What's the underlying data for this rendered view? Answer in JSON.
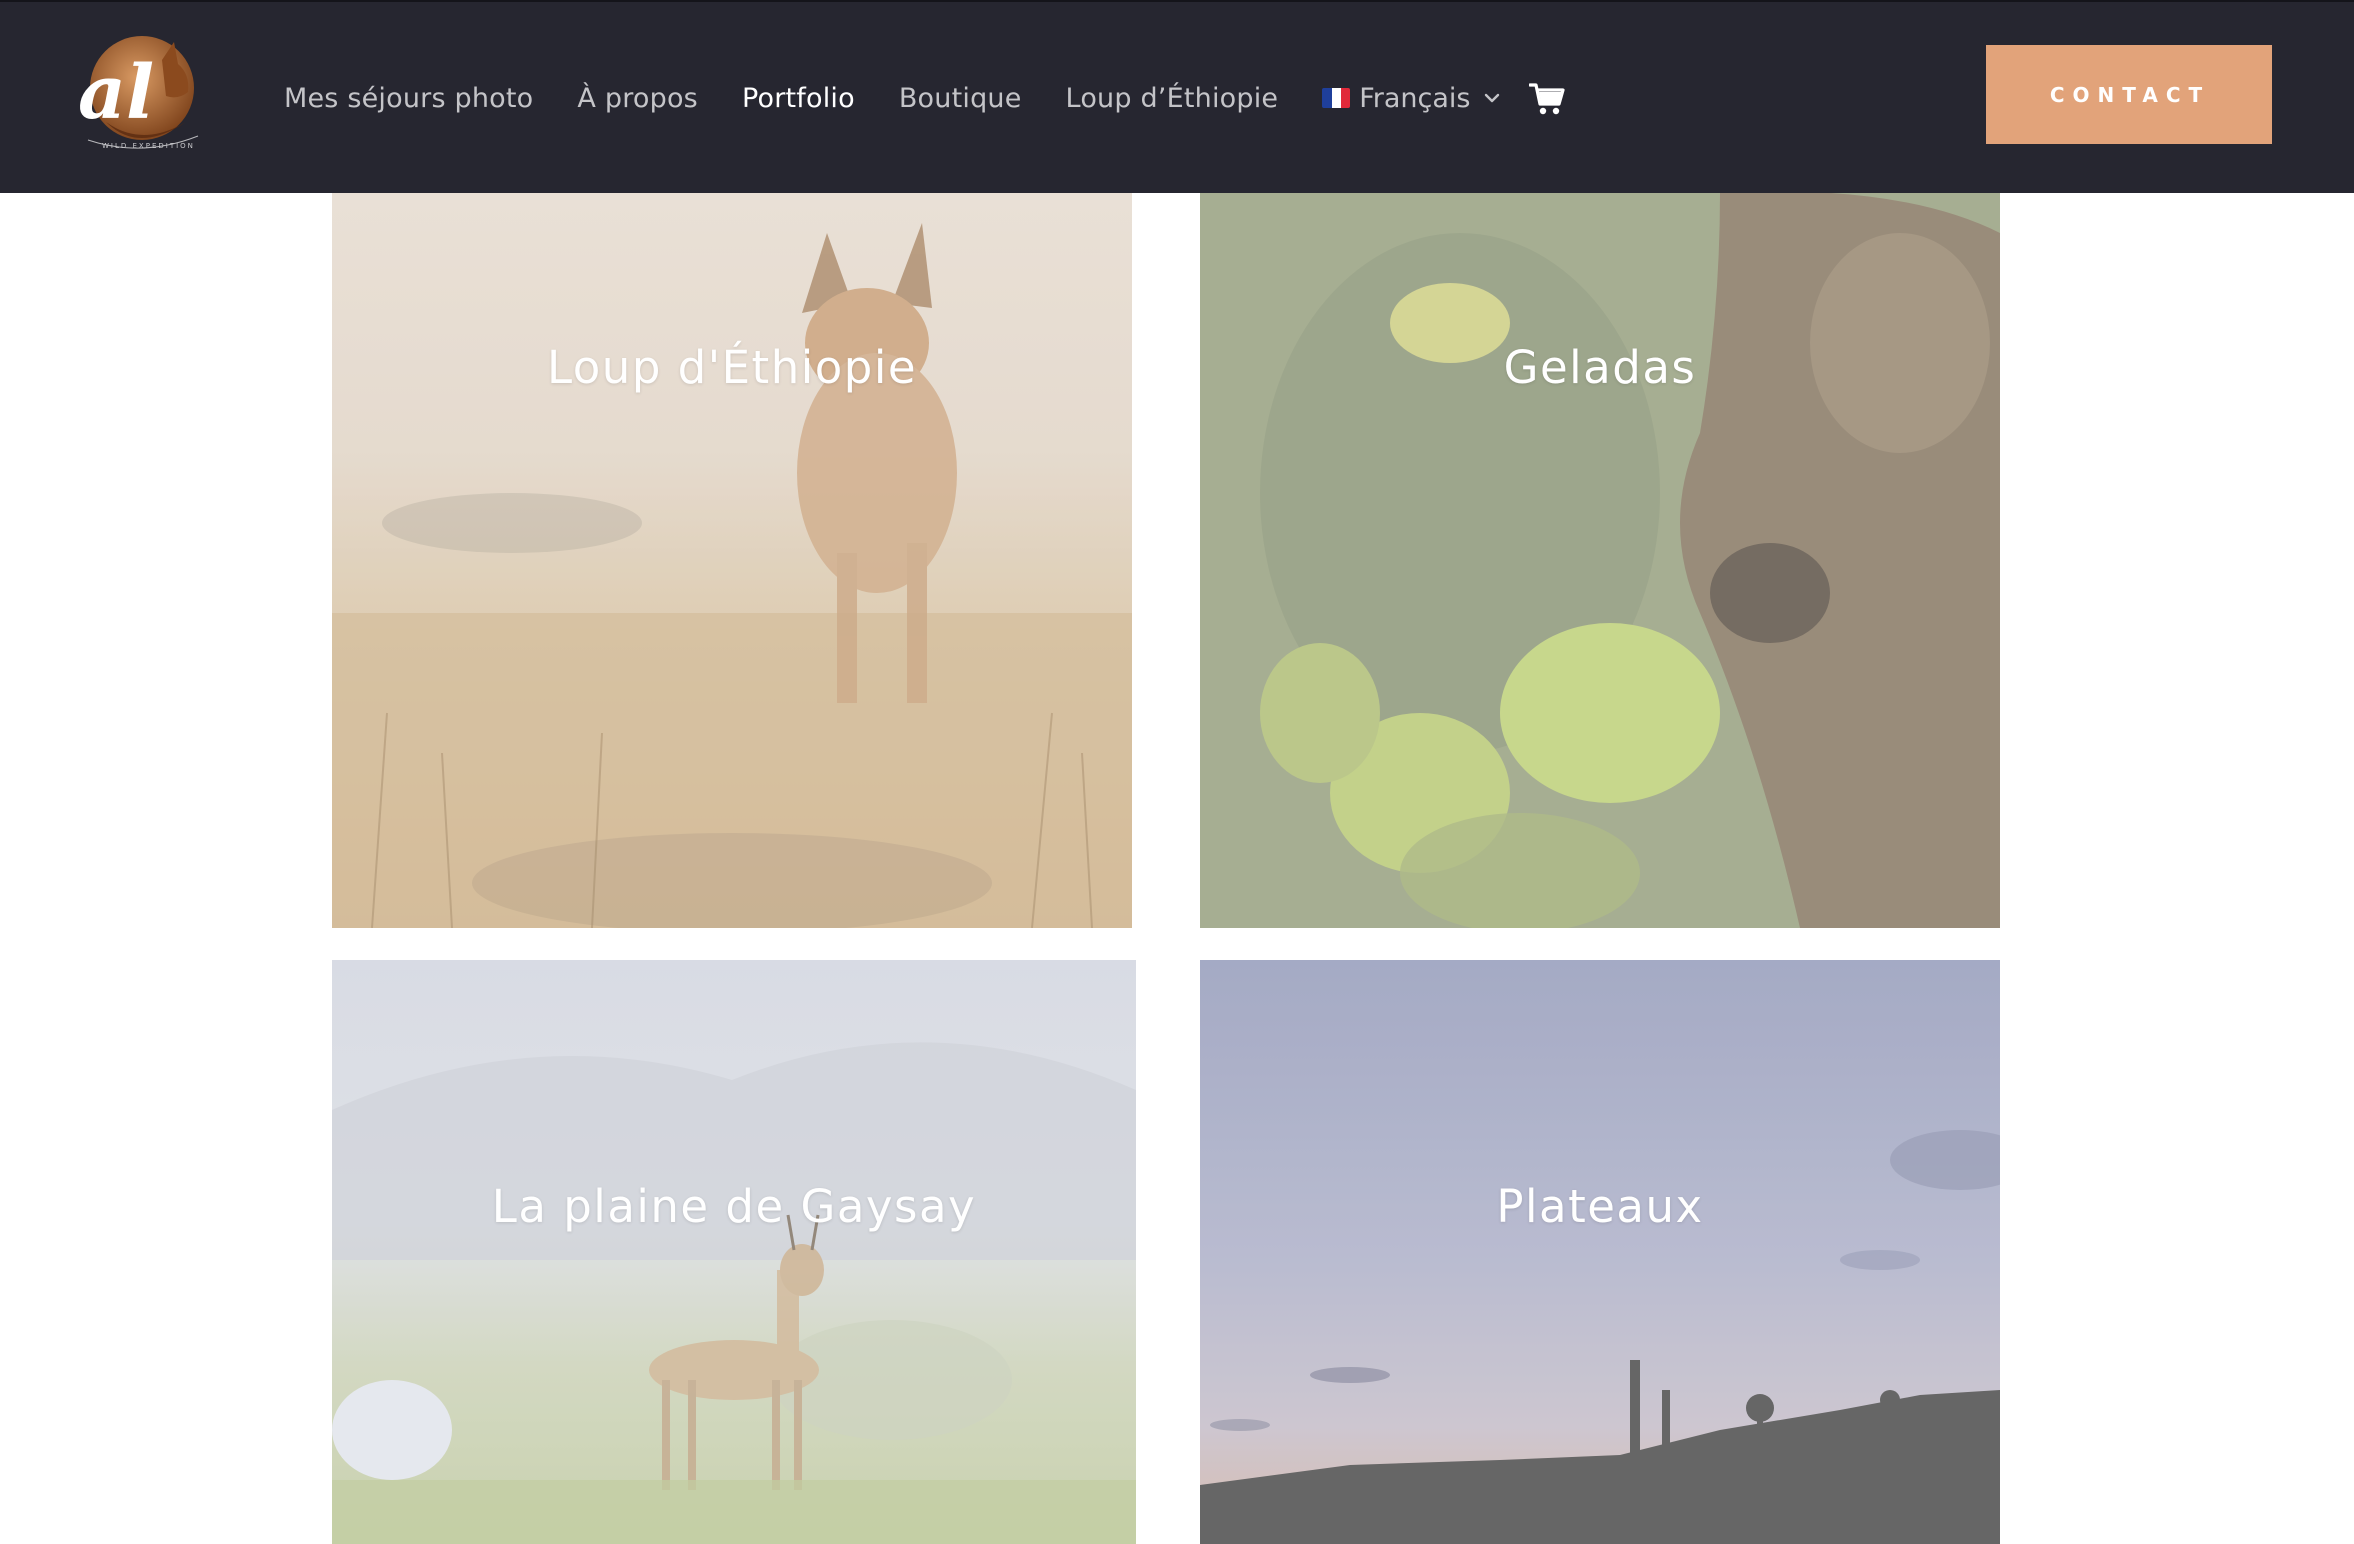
{
  "header": {
    "logo_alt": "al wild expedition",
    "nav": [
      {
        "label": "Mes séjours photo"
      },
      {
        "label": "À propos"
      },
      {
        "label": "Portfolio",
        "active": true
      },
      {
        "label": "Boutique"
      },
      {
        "label": "Loup d’Éthiopie"
      }
    ],
    "language": {
      "label": "Français",
      "flag": [
        "#1f3f9b",
        "#ffffff",
        "#e1293a"
      ]
    },
    "cart_icon": "cart-icon",
    "contact_label": "CONTACT"
  },
  "colors": {
    "header_bg": "#262630",
    "accent": "#e2a37a",
    "nav_text": "#c4c4c8",
    "nav_active": "#ffffff"
  },
  "portfolio": {
    "tiles": [
      {
        "title": "Loup d'Éthiopie"
      },
      {
        "title": "Geladas"
      },
      {
        "title": "La plaine de Gaysay"
      },
      {
        "title": "Plateaux"
      }
    ]
  }
}
